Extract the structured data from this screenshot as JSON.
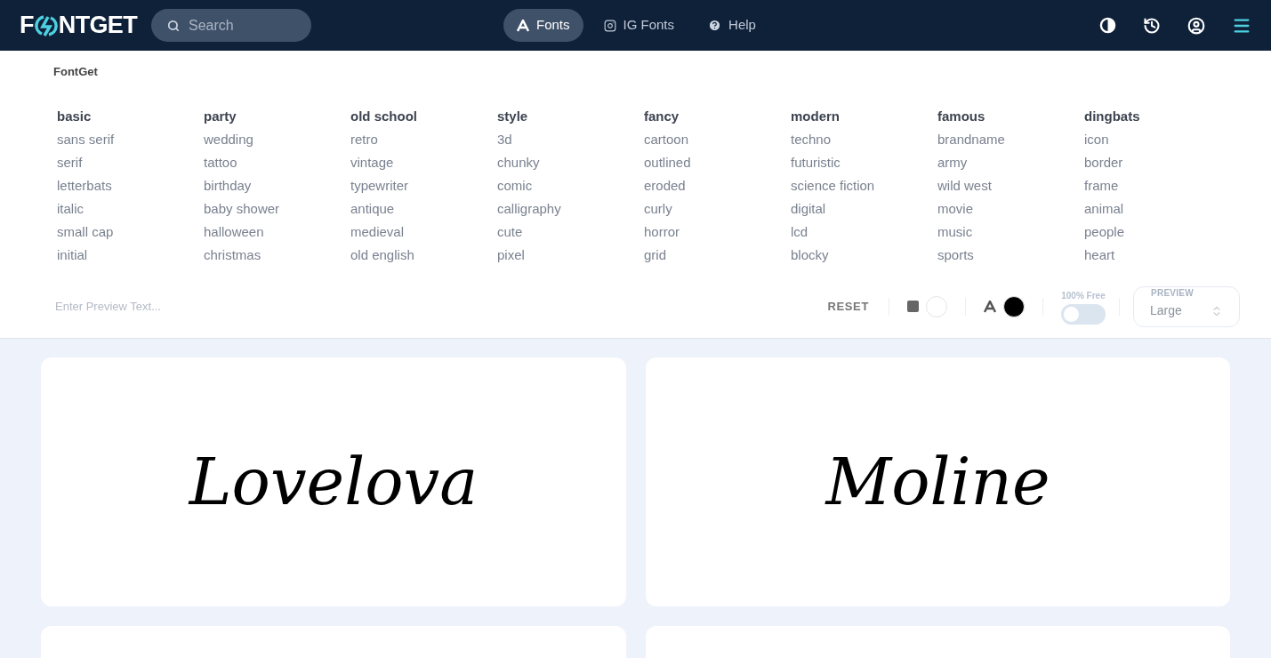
{
  "header": {
    "logo_left": "F",
    "logo_right": "NTGET",
    "search": {
      "placeholder": "Search"
    },
    "nav": [
      {
        "label": "Fonts",
        "selected": true
      },
      {
        "label": "IG Fonts",
        "selected": false
      },
      {
        "label": "Help",
        "selected": false
      }
    ]
  },
  "menu": {
    "title": "FontGet",
    "categories": [
      {
        "heading": "basic",
        "items": [
          "sans serif",
          "serif",
          "letterbats",
          "italic",
          "small cap",
          "initial"
        ]
      },
      {
        "heading": "party",
        "items": [
          "wedding",
          "tattoo",
          "birthday",
          "baby shower",
          "halloween",
          "christmas"
        ]
      },
      {
        "heading": "old school",
        "items": [
          "retro",
          "vintage",
          "typewriter",
          "antique",
          "medieval",
          "old english"
        ]
      },
      {
        "heading": "style",
        "items": [
          "3d",
          "chunky",
          "comic",
          "calligraphy",
          "cute",
          "pixel"
        ]
      },
      {
        "heading": "fancy",
        "items": [
          "cartoon",
          "outlined",
          "eroded",
          "curly",
          "horror",
          "grid"
        ]
      },
      {
        "heading": "modern",
        "items": [
          "techno",
          "futuristic",
          "science fiction",
          "digital",
          "lcd",
          "blocky"
        ]
      },
      {
        "heading": "famous",
        "items": [
          "brandname",
          "army",
          "wild west",
          "movie",
          "music",
          "sports"
        ]
      },
      {
        "heading": "dingbats",
        "items": [
          "icon",
          "border",
          "frame",
          "animal",
          "people",
          "heart"
        ]
      }
    ]
  },
  "toolbar": {
    "preview_text": {
      "placeholder": "Enter Preview Text..."
    },
    "reset": "RESET",
    "color_pickers": [
      {
        "kind": "background",
        "color": "#ffffff"
      },
      {
        "kind": "text",
        "color": "#000000"
      }
    ],
    "free_label": "100% Free",
    "free_on": false,
    "preview_label": "PREVIEW",
    "preview_size": "Large"
  },
  "cards": [
    {
      "preview": "Lovelova"
    },
    {
      "preview": "Moline"
    }
  ]
}
